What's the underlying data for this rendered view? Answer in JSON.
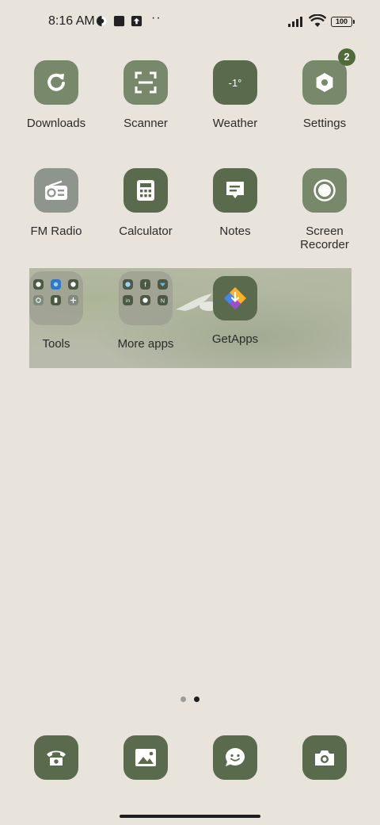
{
  "status_bar": {
    "time": "8:16 AM",
    "battery": "100"
  },
  "apps": {
    "row1": [
      {
        "label": "Downloads",
        "icon": "downloads-icon"
      },
      {
        "label": "Scanner",
        "icon": "scanner-icon"
      },
      {
        "label": "Weather",
        "icon": "weather-icon",
        "temp": "-1°"
      },
      {
        "label": "Settings",
        "icon": "settings-icon",
        "badge": "2"
      }
    ],
    "row2": [
      {
        "label": "FM Radio",
        "icon": "radio-icon"
      },
      {
        "label": "Calculator",
        "icon": "calculator-icon"
      },
      {
        "label": "Notes",
        "icon": "notes-icon"
      },
      {
        "label": "Screen Recorder",
        "icon": "record-icon"
      }
    ],
    "row3": [
      {
        "label": "Tools",
        "icon": "folder-icon"
      },
      {
        "label": "More apps",
        "icon": "folder-icon"
      },
      {
        "label": "GetApps",
        "icon": "getapps-icon"
      }
    ]
  },
  "dock": [
    {
      "name": "phone",
      "icon": "phone-icon"
    },
    {
      "name": "gallery",
      "icon": "gallery-icon"
    },
    {
      "name": "messages",
      "icon": "messages-icon"
    },
    {
      "name": "camera",
      "icon": "camera-icon"
    }
  ],
  "pager": {
    "total": 2,
    "current": 2
  },
  "colors": {
    "background": "#E8E4DB",
    "tile_light": "#77896A",
    "tile_dark": "#5A6A4D",
    "badge": "#4F6B3A"
  }
}
